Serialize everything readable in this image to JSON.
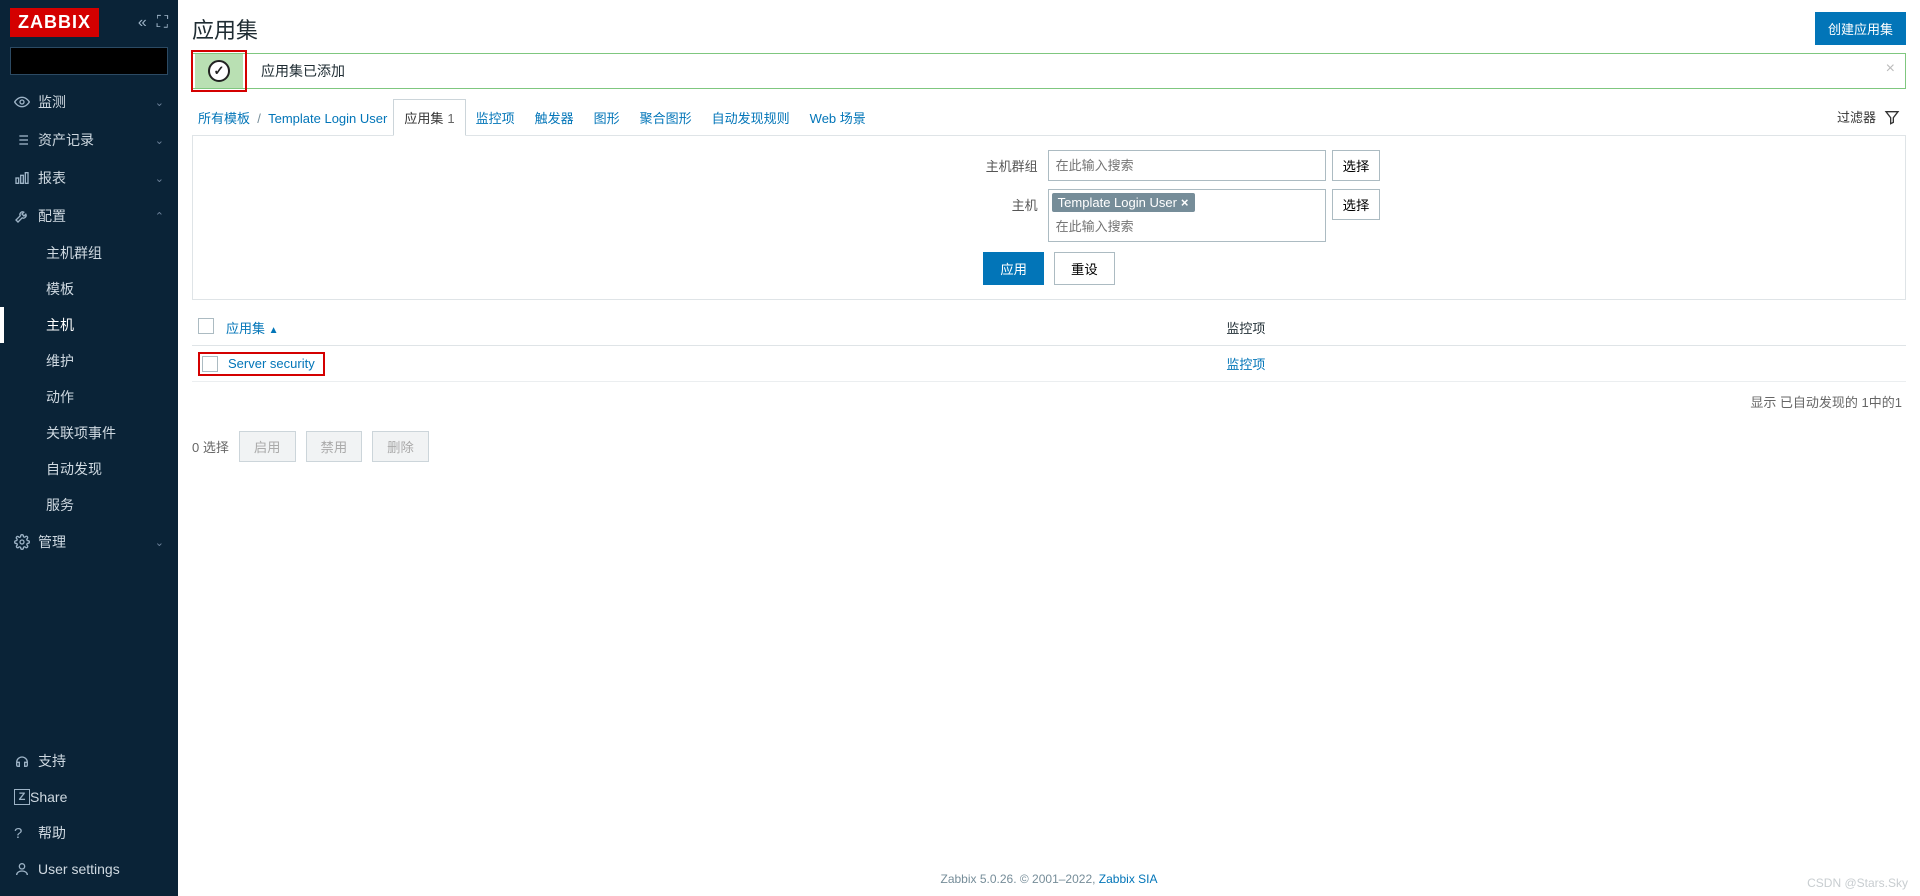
{
  "brand": "ZABBIX",
  "sidebar": {
    "nav": [
      {
        "icon": "eye",
        "label": "监测"
      },
      {
        "icon": "list",
        "label": "资产记录"
      },
      {
        "icon": "chart",
        "label": "报表"
      },
      {
        "icon": "wrench",
        "label": "配置",
        "expanded": true,
        "sub": [
          {
            "label": "主机群组"
          },
          {
            "label": "模板"
          },
          {
            "label": "主机",
            "active": true
          },
          {
            "label": "维护"
          },
          {
            "label": "动作"
          },
          {
            "label": "关联项事件"
          },
          {
            "label": "自动发现"
          },
          {
            "label": "服务"
          }
        ]
      },
      {
        "icon": "gear",
        "label": "管理"
      }
    ],
    "footer": [
      {
        "icon": "headset",
        "label": "支持"
      },
      {
        "icon": "z",
        "label": "Share"
      },
      {
        "icon": "help",
        "label": "帮助"
      },
      {
        "icon": "user",
        "label": "User settings"
      }
    ]
  },
  "page": {
    "title": "应用集",
    "create_btn": "创建应用集"
  },
  "message": {
    "text": "应用集已添加"
  },
  "breadcrumb": {
    "root": "所有模板",
    "sep": "/",
    "current": "Template Login User"
  },
  "tabs": [
    {
      "label": "应用集",
      "count": "1",
      "active": true
    },
    {
      "label": "监控项"
    },
    {
      "label": "触发器"
    },
    {
      "label": "图形"
    },
    {
      "label": "聚合图形"
    },
    {
      "label": "自动发现规则"
    },
    {
      "label": "Web 场景"
    }
  ],
  "filter": {
    "toggle_label": "过滤器",
    "hostgroup_label": "主机群组",
    "host_label": "主机",
    "search_placeholder": "在此输入搜索",
    "host_tag": "Template Login User",
    "select_btn": "选择",
    "apply_btn": "应用",
    "reset_btn": "重设"
  },
  "table": {
    "col_app": "应用集",
    "col_items": "监控项",
    "rows": [
      {
        "name": "Server security",
        "items_link": "监控项"
      }
    ],
    "footer": "显示 已自动发现的 1中的1"
  },
  "bulk": {
    "selected": "0 选择",
    "enable": "启用",
    "disable": "禁用",
    "delete": "删除"
  },
  "footer": {
    "text_left": "Zabbix 5.0.26. © 2001–2022, ",
    "link": "Zabbix SIA"
  },
  "watermark": "CSDN @Stars.Sky"
}
